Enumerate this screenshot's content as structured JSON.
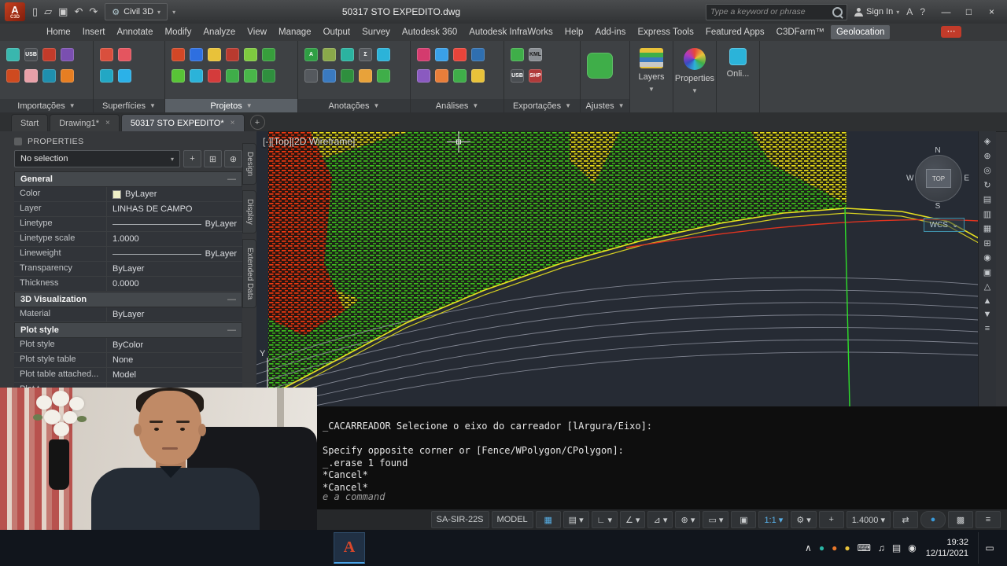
{
  "titlebar": {
    "app_icon": "A",
    "app_label": "C3D",
    "qat_icons": [
      "▯",
      "▱",
      "▣",
      "↶",
      "↷"
    ],
    "workspace": "Civil 3D",
    "gear_icon": "⚙",
    "caret": "▾",
    "title": "50317 STO EXPEDITO.dwg",
    "search_placeholder": "Type a keyword or phrase",
    "sign_in": "Sign In",
    "exchange_icon": "A",
    "help_icon": "?",
    "window": {
      "minimize": "—",
      "maximize": "□",
      "close": "×"
    }
  },
  "menubar": {
    "tabs": [
      {
        "label": "Home"
      },
      {
        "label": "Insert"
      },
      {
        "label": "Annotate"
      },
      {
        "label": "Modify"
      },
      {
        "label": "Analyze"
      },
      {
        "label": "View"
      },
      {
        "label": "Manage"
      },
      {
        "label": "Output"
      },
      {
        "label": "Survey"
      },
      {
        "label": "Autodesk 360"
      },
      {
        "label": "Autodesk InfraWorks"
      },
      {
        "label": "Help"
      },
      {
        "label": "Add-ins"
      },
      {
        "label": "Express Tools"
      },
      {
        "label": "Featured Apps"
      },
      {
        "label": "C3DFarm™"
      },
      {
        "label": "Geolocation",
        "cls": "active"
      }
    ],
    "notification": "⋯"
  },
  "ribbon": {
    "caret": "▼",
    "panels": [
      {
        "label": "Importações",
        "icons": [
          {
            "bg": "#39b7ae"
          },
          {
            "bg": "#cf4a1f"
          },
          {
            "t": "USB",
            "bg": "#4a4e52"
          },
          {
            "bg": "#e8a0a8"
          },
          {
            "bg": "#c23b2a"
          },
          {
            "bg": "#1f8fae"
          },
          {
            "bg": "#7a4fb0"
          },
          {
            "bg": "#e67e22"
          }
        ]
      },
      {
        "label": "Superfícies",
        "icons": [
          {
            "bg": "#d94f3d"
          },
          {
            "bg": "#22a7c4"
          },
          {
            "bg": "#e4555f"
          },
          {
            "bg": "#2bb1e8"
          }
        ]
      },
      {
        "label": "Projetos",
        "cls": "active",
        "icons": [
          {
            "bg": "#d24726"
          },
          {
            "bg": "#58c437"
          },
          {
            "bg": "#2e6fe0"
          },
          {
            "bg": "#2bb3d9"
          },
          {
            "bg": "#e8c23a"
          },
          {
            "bg": "#d43b3b"
          },
          {
            "bg": "#b93a2f"
          },
          {
            "bg": "#3fae49"
          },
          {
            "bg": "#7ec93f"
          },
          {
            "bg": "#49b649"
          },
          {
            "bg": "#379e3c"
          },
          {
            "bg": "#2f8f3e"
          }
        ]
      },
      {
        "label": "Anotações",
        "icons": [
          {
            "t": "A",
            "bg": "#2f9e44"
          },
          {
            "bg": "#55595e"
          },
          {
            "bg": "#8aa84a"
          },
          {
            "bg": "#3a7ac0"
          },
          {
            "bg": "#2bb3a0"
          },
          {
            "bg": "#2f8f3e"
          },
          {
            "t": "Σ",
            "bg": "#55595e"
          },
          {
            "bg": "#e8a23a"
          },
          {
            "bg": "#2bb3d9"
          },
          {
            "bg": "#3fae49"
          }
        ]
      },
      {
        "label": "Análises",
        "icons": [
          {
            "bg": "#d43b6e"
          },
          {
            "bg": "#8a5ac0"
          },
          {
            "bg": "#3aa0e8"
          },
          {
            "bg": "#e87e3a"
          },
          {
            "bg": "#e8443a"
          },
          {
            "bg": "#3fae49"
          },
          {
            "bg": "#2f6fb0"
          },
          {
            "bg": "#e8c23a"
          }
        ]
      },
      {
        "label": "Exportações",
        "icons": [
          {
            "bg": "#3fae49"
          },
          {
            "t": "USB",
            "bg": "#4a4e52"
          },
          {
            "t": "KML",
            "bg": "#8a8f94",
            "fg": "#1a1a1a"
          },
          {
            "t": "SHP",
            "bg": "#b03a3a"
          }
        ]
      },
      {
        "label": "Ajustes",
        "icons": [
          {
            "bg": "#3fae49",
            "cls": "big"
          }
        ]
      }
    ],
    "tall_panels": [
      {
        "label": "Layers"
      },
      {
        "label": "Properties"
      },
      {
        "label": "Onli..."
      }
    ]
  },
  "doc_tabs": [
    {
      "label": "Start"
    },
    {
      "label": "Drawing1*",
      "close": "×"
    },
    {
      "label": "50317 STO EXPEDITO*",
      "close": "×",
      "cls": "active"
    }
  ],
  "doc_tab_add": "+",
  "palette": {
    "title": "PROPERTIES",
    "selection": "No selection",
    "caret": "▾",
    "collapse": "—",
    "tools": [
      "+",
      "⊞",
      "⊕"
    ],
    "sections": {
      "general": {
        "title": "General",
        "rows": [
          {
            "label": "Color",
            "value": "ByLayer",
            "cls": "has-swatch"
          },
          {
            "label": "Layer",
            "value": "LINHAS DE CAMPO"
          },
          {
            "label": "Linetype",
            "value": "ByLayer",
            "cls": "has-line"
          },
          {
            "label": "Linetype scale",
            "value": "1.0000"
          },
          {
            "label": "Lineweight",
            "value": "ByLayer",
            "cls": "has-line"
          },
          {
            "label": "Transparency",
            "value": "ByLayer"
          },
          {
            "label": "Thickness",
            "value": "0.0000"
          }
        ]
      },
      "viz": {
        "title": "3D Visualization",
        "rows": [
          {
            "label": "Material",
            "value": "ByLayer"
          }
        ]
      },
      "plot": {
        "title": "Plot style",
        "rows": [
          {
            "label": "Plot style",
            "value": "ByColor"
          },
          {
            "label": "Plot style table",
            "value": "None"
          },
          {
            "label": "Plot table attached...",
            "value": "Model"
          },
          {
            "label": "Plot t...",
            "value": ""
          }
        ]
      }
    },
    "side_tabs": [
      "Design",
      "Display",
      "Extended Data"
    ]
  },
  "viewport": {
    "label": "[-][Top][2D Wireframe]",
    "axis_label": "Y",
    "nav_icons": [
      "◈",
      "⊕",
      "◎",
      "↻",
      "▤",
      "▥",
      "▦",
      "⊞",
      "◉",
      "▣",
      "△",
      "▲",
      "▼",
      "≡"
    ],
    "viewcube": {
      "n": "N",
      "s": "S",
      "w": "W",
      "e": "E",
      "top": "TOP",
      "wcs": "WCS",
      "caret": "⌄"
    }
  },
  "command": {
    "lines": [
      "_CACARREADOR Selecione o eixo do carreador [lArgura/Eixo]:",
      "",
      "Specify opposite corner or [Fence/WPolygon/CPolygon]:",
      "_.erase 1 found",
      "*Cancel*",
      "*Cancel*"
    ],
    "prompt": "e a command"
  },
  "status": {
    "items": [
      {
        "label": "SA-SIR-22S"
      },
      {
        "label": "MODEL"
      },
      {
        "label": "▦",
        "cls": "on"
      },
      {
        "label": "▤ ▾"
      },
      {
        "label": "∟ ▾"
      },
      {
        "label": "∠ ▾"
      },
      {
        "label": "⊿ ▾"
      },
      {
        "label": "⊕ ▾"
      },
      {
        "label": "▭ ▾"
      },
      {
        "label": "▣"
      },
      {
        "label": "1:1 ▾",
        "cls": "on"
      },
      {
        "label": "⚙ ▾"
      },
      {
        "label": "+"
      },
      {
        "label": "1.4000 ▾"
      },
      {
        "label": "⇄"
      },
      {
        "label": "●",
        "cls": "blue"
      },
      {
        "label": "▩"
      },
      {
        "label": "≡"
      }
    ]
  },
  "taskbar": {
    "app_icon": "A",
    "tray_icons": [
      {
        "label": "∧"
      },
      {
        "label": "●",
        "cls": "teal"
      },
      {
        "label": "●",
        "cls": "orange"
      },
      {
        "label": "●",
        "cls": "yellow"
      },
      {
        "label": "⌨"
      },
      {
        "label": "♫"
      },
      {
        "label": "▤"
      },
      {
        "label": "◉"
      }
    ],
    "time": "19:32",
    "date": "12/11/2021",
    "action_icon": "▭"
  },
  "colors": {
    "surface_green": "#3fc01e",
    "surface_yellow": "#e8e018",
    "surface_red": "#f03a10",
    "contour_gray": "#8f93a0",
    "accent_blue": "#4aa3e8"
  }
}
